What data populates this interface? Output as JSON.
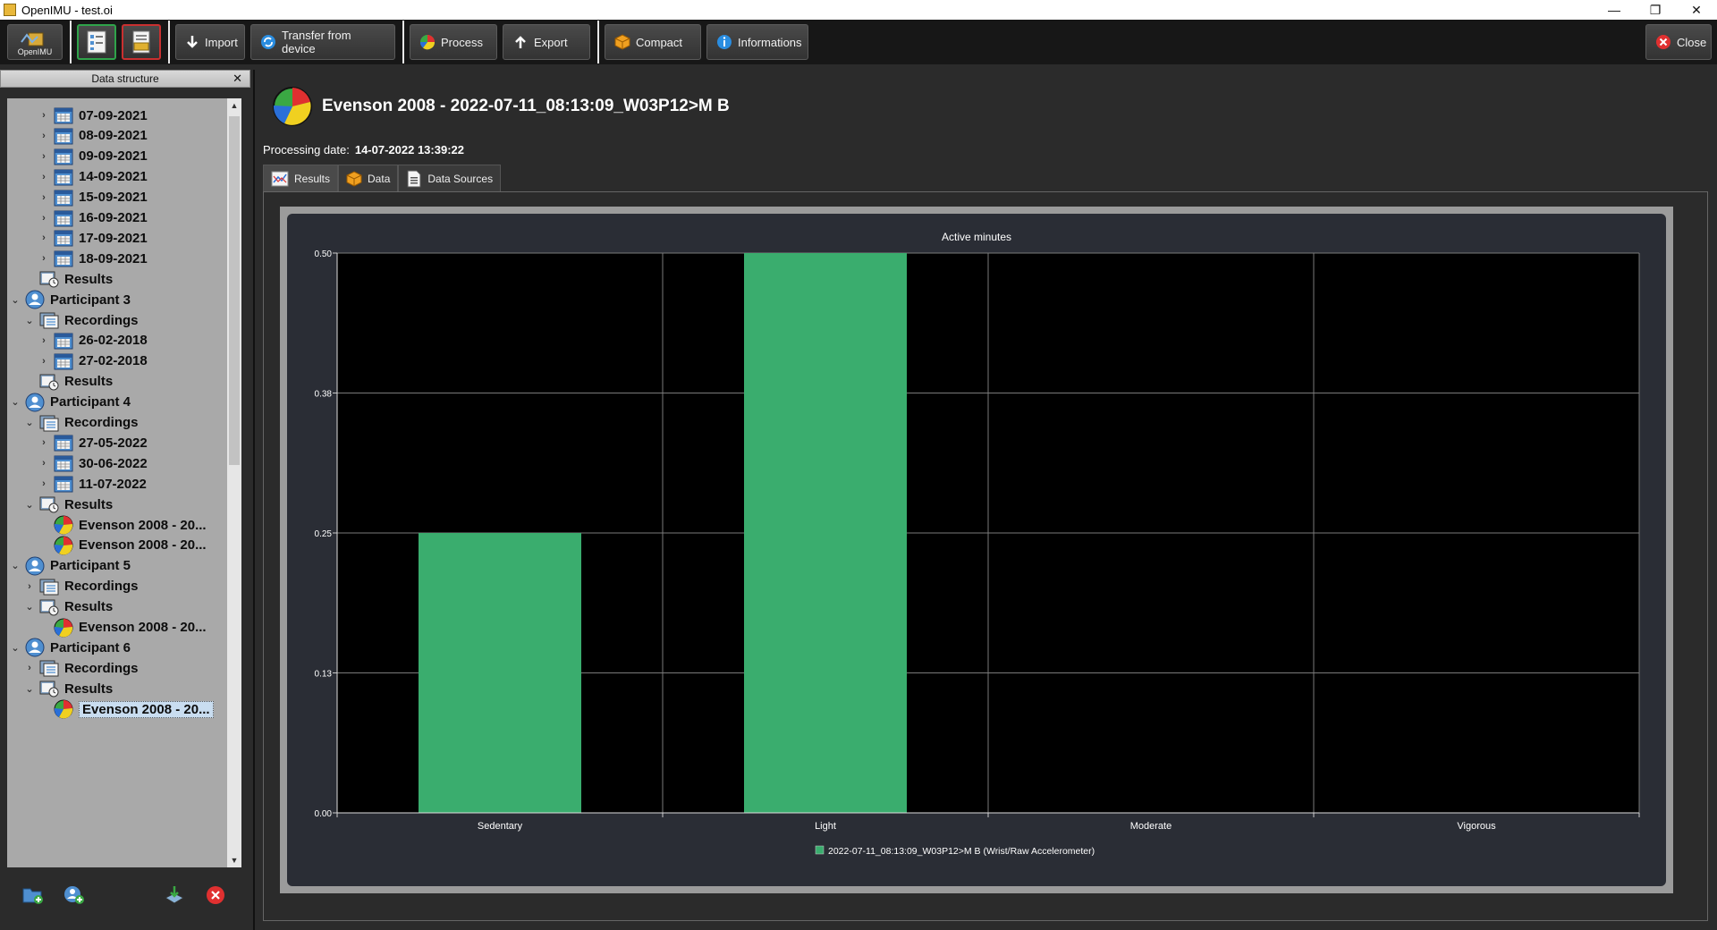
{
  "window": {
    "title": "OpenIMU - test.oi",
    "minimize": "—",
    "restore": "❐",
    "close": "✕"
  },
  "toolbar": {
    "logo_label": "OpenIMU",
    "import": "Import",
    "transfer": "Transfer from device",
    "process": "Process",
    "export": "Export",
    "compact": "Compact",
    "informations": "Informations",
    "close": "Close"
  },
  "dock": {
    "title": "Data structure",
    "close": "✕",
    "tree": [
      {
        "label": "07-09-2021",
        "level": 2,
        "type": "recording",
        "arrow": "›"
      },
      {
        "label": "08-09-2021",
        "level": 2,
        "type": "recording",
        "arrow": "›"
      },
      {
        "label": "09-09-2021",
        "level": 2,
        "type": "recording",
        "arrow": "›"
      },
      {
        "label": "14-09-2021",
        "level": 2,
        "type": "recording",
        "arrow": "›"
      },
      {
        "label": "15-09-2021",
        "level": 2,
        "type": "recording",
        "arrow": "›"
      },
      {
        "label": "16-09-2021",
        "level": 2,
        "type": "recording",
        "arrow": "›"
      },
      {
        "label": "17-09-2021",
        "level": 2,
        "type": "recording",
        "arrow": "›"
      },
      {
        "label": "18-09-2021",
        "level": 2,
        "type": "recording",
        "arrow": "›"
      },
      {
        "label": "Results",
        "level": 1,
        "type": "results",
        "arrow": ""
      },
      {
        "label": "Participant 3",
        "level": 0,
        "type": "participant",
        "arrow": "⌄"
      },
      {
        "label": "Recordings",
        "level": 1,
        "type": "recordings",
        "arrow": "⌄"
      },
      {
        "label": "26-02-2018",
        "level": 2,
        "type": "recording",
        "arrow": "›"
      },
      {
        "label": "27-02-2018",
        "level": 2,
        "type": "recording",
        "arrow": "›"
      },
      {
        "label": "Results",
        "level": 1,
        "type": "results",
        "arrow": ""
      },
      {
        "label": "Participant 4",
        "level": 0,
        "type": "participant",
        "arrow": "⌄"
      },
      {
        "label": "Recordings",
        "level": 1,
        "type": "recordings",
        "arrow": "⌄"
      },
      {
        "label": "27-05-2022",
        "level": 2,
        "type": "recording",
        "arrow": "›"
      },
      {
        "label": "30-06-2022",
        "level": 2,
        "type": "recording",
        "arrow": "›"
      },
      {
        "label": "11-07-2022",
        "level": 2,
        "type": "recording",
        "arrow": "›"
      },
      {
        "label": "Results",
        "level": 1,
        "type": "results",
        "arrow": "⌄"
      },
      {
        "label": "Evenson 2008 - 20...",
        "level": 2,
        "type": "result",
        "arrow": ""
      },
      {
        "label": "Evenson 2008 - 20...",
        "level": 2,
        "type": "result",
        "arrow": ""
      },
      {
        "label": "Participant 5",
        "level": 0,
        "type": "participant",
        "arrow": "⌄"
      },
      {
        "label": "Recordings",
        "level": 1,
        "type": "recordings",
        "arrow": "›"
      },
      {
        "label": "Results",
        "level": 1,
        "type": "results",
        "arrow": "⌄"
      },
      {
        "label": "Evenson 2008 - 20...",
        "level": 2,
        "type": "result",
        "arrow": ""
      },
      {
        "label": "Participant 6",
        "level": 0,
        "type": "participant",
        "arrow": "⌄"
      },
      {
        "label": "Recordings",
        "level": 1,
        "type": "recordings",
        "arrow": "›"
      },
      {
        "label": "Results",
        "level": 1,
        "type": "results",
        "arrow": "⌄"
      },
      {
        "label": "Evenson 2008 - 20...",
        "level": 2,
        "type": "result",
        "arrow": "",
        "selected": true
      }
    ]
  },
  "result": {
    "title": "Evenson 2008 - 2022-07-11_08:13:09_W03P12>M B",
    "processing_label": "Processing date:",
    "processing_date": "14-07-2022 13:39:22"
  },
  "tabs": [
    "Results",
    "Data",
    "Data Sources"
  ],
  "colors": {
    "bar": "#3aad6e",
    "plot_bg": "#000000",
    "frame_bg": "#2a2d35",
    "grid": "#7a7a7a"
  },
  "chart_data": {
    "type": "bar",
    "title": "Active minutes",
    "categories": [
      "Sedentary",
      "Light",
      "Moderate",
      "Vigorous"
    ],
    "series": [
      {
        "name": "2022-07-11_08:13:09_W03P12>M B (Wrist/Raw Accelerometer)",
        "values": [
          0.25,
          0.5,
          0,
          0
        ]
      }
    ],
    "yticks": [
      "0.00",
      "0.13",
      "0.25",
      "0.38",
      "0.50"
    ],
    "ylim": [
      0,
      0.5
    ],
    "grid": true,
    "legend": "bottom"
  }
}
